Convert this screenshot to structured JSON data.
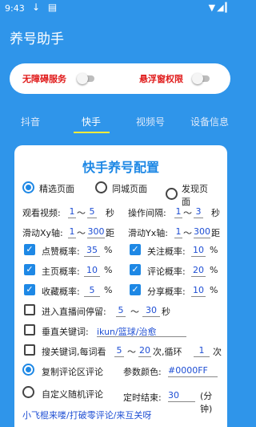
{
  "status_bar": {
    "time": "9:43",
    "icons_left": "↓ ▤",
    "icons_right": "▼◢▎"
  },
  "app": {
    "title": "养号助手"
  },
  "permissions": {
    "accessibility_label": "无障碍服务",
    "accessibility_enabled": false,
    "overlay_label": "悬浮窗权限",
    "overlay_enabled": false
  },
  "tabs": [
    {
      "label": "抖音",
      "active": false
    },
    {
      "label": "快手",
      "active": true
    },
    {
      "label": "视频号",
      "active": false
    },
    {
      "label": "设备信息",
      "active": false
    }
  ],
  "config": {
    "title": "快手养号配置",
    "page_mode": {
      "options": [
        "精选页面",
        "同城页面",
        "发现页面"
      ],
      "selected": "精选页面",
      "option3_line1": "发现页",
      "option3_line2": "面"
    },
    "watch_video": {
      "label": "观看视频:",
      "min": "1",
      "sep": "～",
      "max": "5",
      "unit": "秒"
    },
    "op_interval": {
      "label": "操作间隔:",
      "min": "1",
      "sep": "～",
      "max": "3",
      "unit": "秒"
    },
    "slide_xy": {
      "label": "滑动Xy轴:",
      "min": "1",
      "sep": "～",
      "max": "300",
      "unit": "距"
    },
    "slide_yx": {
      "label": "滑动Yx轴:",
      "min": "1",
      "sep": "～",
      "max": "300",
      "unit": "距"
    },
    "probabilities": [
      {
        "label": "点赞概率:",
        "value": "35",
        "unit": "%",
        "checked": true
      },
      {
        "label": "关注概率:",
        "value": "10",
        "unit": "%",
        "checked": true
      },
      {
        "label": "主页概率:",
        "value": "10",
        "unit": "%",
        "checked": true
      },
      {
        "label": "评论概率:",
        "value": "20",
        "unit": "%",
        "checked": true
      },
      {
        "label": "收藏概率:",
        "value": "5",
        "unit": "%",
        "checked": true
      },
      {
        "label": "分享概率:",
        "value": "10",
        "unit": "%",
        "checked": true
      }
    ],
    "live_stay": {
      "label": "进入直播间停留:",
      "min": "5",
      "sep": "～",
      "max": "30",
      "unit": "秒",
      "checked": false
    },
    "vertical_keywords": {
      "label": "垂直关键词:",
      "value": "ikun/篮球/治愈",
      "checked": false
    },
    "search_keywords": {
      "label": "搜关键词,每词看",
      "min": "5",
      "sep": "～",
      "max": "20",
      "unit": "次,循环",
      "loop": "1",
      "loop_unit": "次",
      "checked": false
    },
    "comment_mode": {
      "copy_label": "复制评论区评论",
      "copy_selected": true,
      "custom_label": "自定义随机评论",
      "custom_selected": false
    },
    "param_color": {
      "label": "参数颜色:",
      "value": "#0000FF"
    },
    "timer_end": {
      "label": "定时结束:",
      "value": "30",
      "unit_line1": "(分",
      "unit_line2": "钟)"
    },
    "custom_comments": "小飞棍来喽/打破零评论/来互关呀"
  },
  "colors": {
    "primary": "#2f95ea",
    "accent": "#1e88e5",
    "permission_red": "#e01a1a",
    "tab_indicator": "#ffeb3b",
    "value_blue": "#1f4fd4"
  }
}
